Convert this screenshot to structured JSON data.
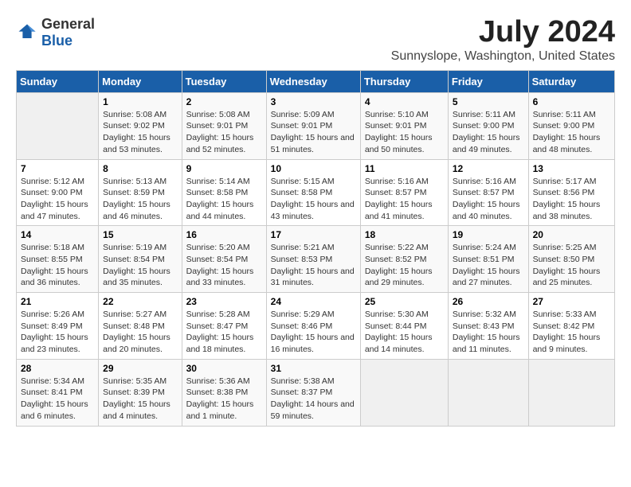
{
  "header": {
    "logo_general": "General",
    "logo_blue": "Blue",
    "month_title": "July 2024",
    "location": "Sunnyslope, Washington, United States"
  },
  "days_of_week": [
    "Sunday",
    "Monday",
    "Tuesday",
    "Wednesday",
    "Thursday",
    "Friday",
    "Saturday"
  ],
  "weeks": [
    [
      {
        "day": "",
        "empty": true
      },
      {
        "day": "1",
        "sunrise": "Sunrise: 5:08 AM",
        "sunset": "Sunset: 9:02 PM",
        "daylight": "Daylight: 15 hours and 53 minutes."
      },
      {
        "day": "2",
        "sunrise": "Sunrise: 5:08 AM",
        "sunset": "Sunset: 9:01 PM",
        "daylight": "Daylight: 15 hours and 52 minutes."
      },
      {
        "day": "3",
        "sunrise": "Sunrise: 5:09 AM",
        "sunset": "Sunset: 9:01 PM",
        "daylight": "Daylight: 15 hours and 51 minutes."
      },
      {
        "day": "4",
        "sunrise": "Sunrise: 5:10 AM",
        "sunset": "Sunset: 9:01 PM",
        "daylight": "Daylight: 15 hours and 50 minutes."
      },
      {
        "day": "5",
        "sunrise": "Sunrise: 5:11 AM",
        "sunset": "Sunset: 9:00 PM",
        "daylight": "Daylight: 15 hours and 49 minutes."
      },
      {
        "day": "6",
        "sunrise": "Sunrise: 5:11 AM",
        "sunset": "Sunset: 9:00 PM",
        "daylight": "Daylight: 15 hours and 48 minutes."
      }
    ],
    [
      {
        "day": "7",
        "sunrise": "Sunrise: 5:12 AM",
        "sunset": "Sunset: 9:00 PM",
        "daylight": "Daylight: 15 hours and 47 minutes."
      },
      {
        "day": "8",
        "sunrise": "Sunrise: 5:13 AM",
        "sunset": "Sunset: 8:59 PM",
        "daylight": "Daylight: 15 hours and 46 minutes."
      },
      {
        "day": "9",
        "sunrise": "Sunrise: 5:14 AM",
        "sunset": "Sunset: 8:58 PM",
        "daylight": "Daylight: 15 hours and 44 minutes."
      },
      {
        "day": "10",
        "sunrise": "Sunrise: 5:15 AM",
        "sunset": "Sunset: 8:58 PM",
        "daylight": "Daylight: 15 hours and 43 minutes."
      },
      {
        "day": "11",
        "sunrise": "Sunrise: 5:16 AM",
        "sunset": "Sunset: 8:57 PM",
        "daylight": "Daylight: 15 hours and 41 minutes."
      },
      {
        "day": "12",
        "sunrise": "Sunrise: 5:16 AM",
        "sunset": "Sunset: 8:57 PM",
        "daylight": "Daylight: 15 hours and 40 minutes."
      },
      {
        "day": "13",
        "sunrise": "Sunrise: 5:17 AM",
        "sunset": "Sunset: 8:56 PM",
        "daylight": "Daylight: 15 hours and 38 minutes."
      }
    ],
    [
      {
        "day": "14",
        "sunrise": "Sunrise: 5:18 AM",
        "sunset": "Sunset: 8:55 PM",
        "daylight": "Daylight: 15 hours and 36 minutes."
      },
      {
        "day": "15",
        "sunrise": "Sunrise: 5:19 AM",
        "sunset": "Sunset: 8:54 PM",
        "daylight": "Daylight: 15 hours and 35 minutes."
      },
      {
        "day": "16",
        "sunrise": "Sunrise: 5:20 AM",
        "sunset": "Sunset: 8:54 PM",
        "daylight": "Daylight: 15 hours and 33 minutes."
      },
      {
        "day": "17",
        "sunrise": "Sunrise: 5:21 AM",
        "sunset": "Sunset: 8:53 PM",
        "daylight": "Daylight: 15 hours and 31 minutes."
      },
      {
        "day": "18",
        "sunrise": "Sunrise: 5:22 AM",
        "sunset": "Sunset: 8:52 PM",
        "daylight": "Daylight: 15 hours and 29 minutes."
      },
      {
        "day": "19",
        "sunrise": "Sunrise: 5:24 AM",
        "sunset": "Sunset: 8:51 PM",
        "daylight": "Daylight: 15 hours and 27 minutes."
      },
      {
        "day": "20",
        "sunrise": "Sunrise: 5:25 AM",
        "sunset": "Sunset: 8:50 PM",
        "daylight": "Daylight: 15 hours and 25 minutes."
      }
    ],
    [
      {
        "day": "21",
        "sunrise": "Sunrise: 5:26 AM",
        "sunset": "Sunset: 8:49 PM",
        "daylight": "Daylight: 15 hours and 23 minutes."
      },
      {
        "day": "22",
        "sunrise": "Sunrise: 5:27 AM",
        "sunset": "Sunset: 8:48 PM",
        "daylight": "Daylight: 15 hours and 20 minutes."
      },
      {
        "day": "23",
        "sunrise": "Sunrise: 5:28 AM",
        "sunset": "Sunset: 8:47 PM",
        "daylight": "Daylight: 15 hours and 18 minutes."
      },
      {
        "day": "24",
        "sunrise": "Sunrise: 5:29 AM",
        "sunset": "Sunset: 8:46 PM",
        "daylight": "Daylight: 15 hours and 16 minutes."
      },
      {
        "day": "25",
        "sunrise": "Sunrise: 5:30 AM",
        "sunset": "Sunset: 8:44 PM",
        "daylight": "Daylight: 15 hours and 14 minutes."
      },
      {
        "day": "26",
        "sunrise": "Sunrise: 5:32 AM",
        "sunset": "Sunset: 8:43 PM",
        "daylight": "Daylight: 15 hours and 11 minutes."
      },
      {
        "day": "27",
        "sunrise": "Sunrise: 5:33 AM",
        "sunset": "Sunset: 8:42 PM",
        "daylight": "Daylight: 15 hours and 9 minutes."
      }
    ],
    [
      {
        "day": "28",
        "sunrise": "Sunrise: 5:34 AM",
        "sunset": "Sunset: 8:41 PM",
        "daylight": "Daylight: 15 hours and 6 minutes."
      },
      {
        "day": "29",
        "sunrise": "Sunrise: 5:35 AM",
        "sunset": "Sunset: 8:39 PM",
        "daylight": "Daylight: 15 hours and 4 minutes."
      },
      {
        "day": "30",
        "sunrise": "Sunrise: 5:36 AM",
        "sunset": "Sunset: 8:38 PM",
        "daylight": "Daylight: 15 hours and 1 minute."
      },
      {
        "day": "31",
        "sunrise": "Sunrise: 5:38 AM",
        "sunset": "Sunset: 8:37 PM",
        "daylight": "Daylight: 14 hours and 59 minutes."
      },
      {
        "day": "",
        "empty": true
      },
      {
        "day": "",
        "empty": true
      },
      {
        "day": "",
        "empty": true
      }
    ]
  ]
}
